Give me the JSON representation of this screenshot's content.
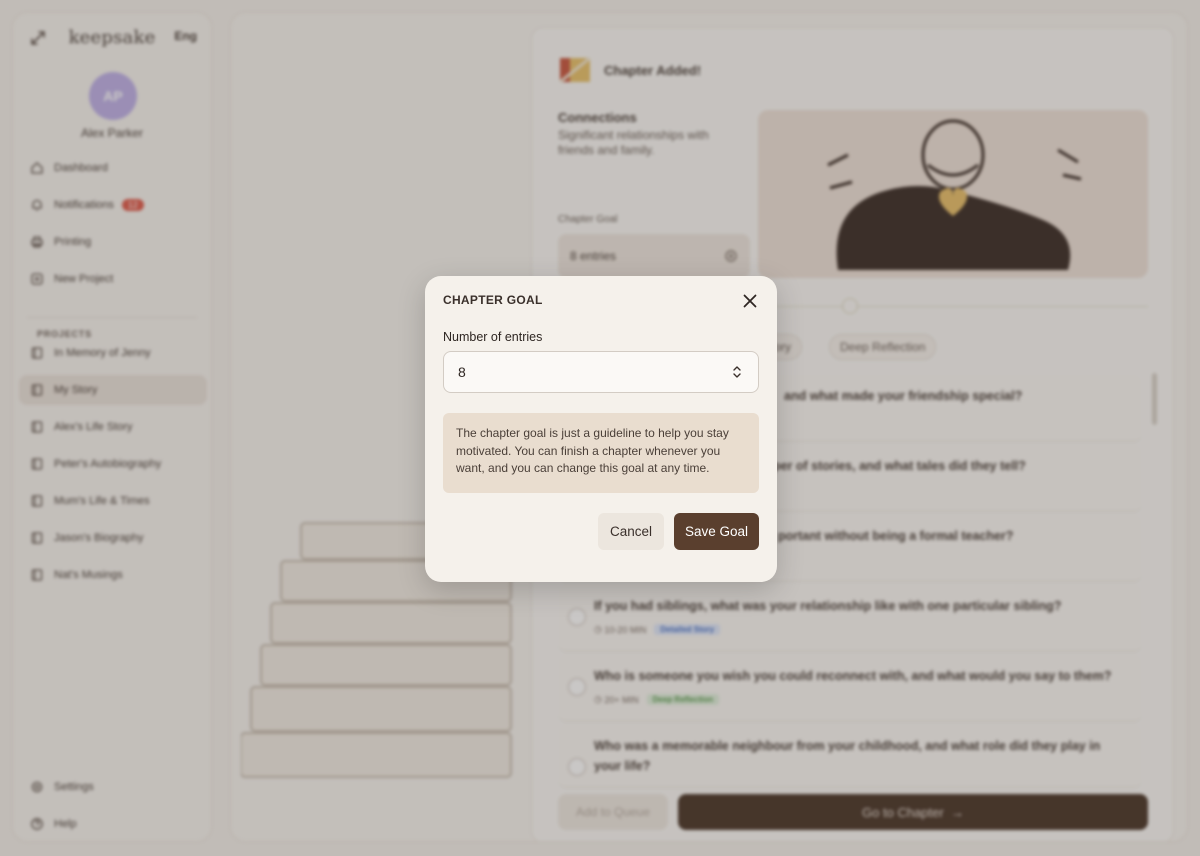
{
  "app": {
    "logo": "keepsake",
    "language": "Eng",
    "user": {
      "initials": "AP",
      "name": "Alex Parker"
    },
    "nav": [
      {
        "label": "Dashboard",
        "icon": "home-icon"
      },
      {
        "label": "Notifications",
        "icon": "bell-icon",
        "badge": "12"
      },
      {
        "label": "Printing",
        "icon": "printer-icon"
      },
      {
        "label": "New Project",
        "icon": "plus-square-icon"
      }
    ],
    "projects_heading": "PROJECTS",
    "projects": [
      {
        "label": "In Memory of Jenny",
        "active": false
      },
      {
        "label": "My Story",
        "active": true
      },
      {
        "label": "Alex's Life Story",
        "active": false
      },
      {
        "label": "Peter's Autobiography",
        "active": false
      },
      {
        "label": "Mum's Life & Times",
        "active": false
      },
      {
        "label": "Jason's Biography",
        "active": false
      },
      {
        "label": "Nat's Musings",
        "active": false
      }
    ],
    "footer_nav": [
      {
        "label": "Settings",
        "icon": "gear-icon"
      },
      {
        "label": "Help",
        "icon": "help-icon"
      }
    ]
  },
  "panel": {
    "header": "Chapter Added!",
    "chapter_name": "Connections",
    "chapter_desc": "Significant relationships with friends and family.",
    "goal_label": "Chapter Goal",
    "goal_value": "8 entries",
    "filters": [
      "Story",
      "Deep Reflection"
    ],
    "questions": [
      {
        "text": "and what made your friendship special?"
      },
      {
        "text": "aper of stories, and what tales did they tell?"
      },
      {
        "text": "portant without being a formal teacher?"
      },
      {
        "text": "If you had siblings, what was your relationship like with one particular sibling?",
        "time": "10-20 MIN",
        "tag": "Detailed Story",
        "tag_color": "blue"
      },
      {
        "text": "Who is someone you wish you could reconnect with, and what would you say to them?",
        "time": "20+ MIN",
        "tag": "Deep Reflection",
        "tag_color": "green"
      },
      {
        "text": "Who was a memorable neighbour from your childhood, and what role did they play in your life?"
      }
    ],
    "add_to_queue": "Add to Queue",
    "go_to_chapter": "Go to Chapter"
  },
  "modal": {
    "title": "CHAPTER GOAL",
    "label": "Number of entries",
    "value": "8",
    "note": "The chapter goal is just a guideline to help you stay motivated. You can finish a chapter whenever you want, and you can change this goal at any time.",
    "cancel": "Cancel",
    "save": "Save Goal"
  },
  "colors": {
    "accent": "#5a3f2e",
    "note_bg": "#e9ddcf",
    "modal_bg": "#f5f1eb",
    "badge": "#e05b4b"
  }
}
